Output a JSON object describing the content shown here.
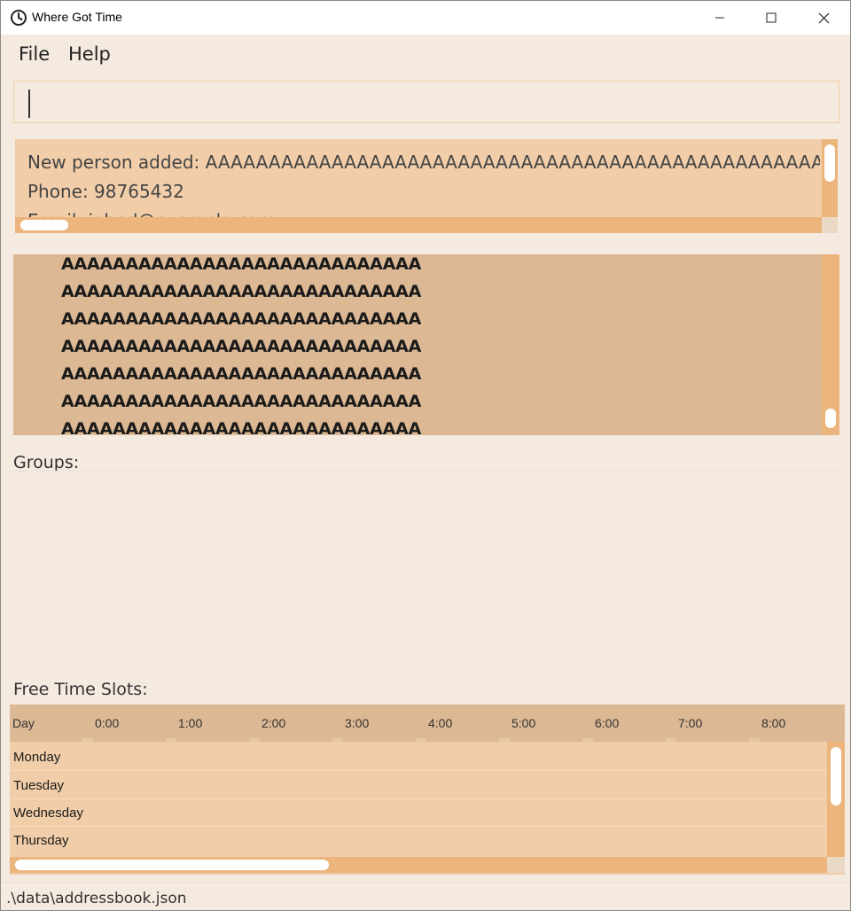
{
  "window": {
    "title": "Where Got Time",
    "icon": "clock-icon",
    "controls": [
      "minimize-icon",
      "maximize-icon",
      "close-icon"
    ]
  },
  "menu": {
    "file": "File",
    "help": "Help"
  },
  "command_box": {
    "value": ""
  },
  "result_display": {
    "lines": [
      "New person added: AAAAAAAAAAAAAAAAAAAAAAAAAAAAAAAAAAAAAAAAAAAAAAAAAAAAAAAA",
      "Phone: 98765432",
      "Email: johnd@example.com"
    ]
  },
  "person_list": {
    "rows": [
      "AAAAAAAAAAAAAAAAAAAAAAAAAAAA",
      "AAAAAAAAAAAAAAAAAAAAAAAAAAAA",
      "AAAAAAAAAAAAAAAAAAAAAAAAAAAA",
      "AAAAAAAAAAAAAAAAAAAAAAAAAAAA",
      "AAAAAAAAAAAAAAAAAAAAAAAAAAAA",
      "AAAAAAAAAAAAAAAAAAAAAAAAAAAA",
      "AAAAAAAAAAAAAAAAAAAAAAAAAAAA"
    ]
  },
  "groups": {
    "label": "Groups:"
  },
  "free_time_slots": {
    "label": "Free Time Slots:",
    "columns": [
      "Day",
      "0:00",
      "1:00",
      "2:00",
      "3:00",
      "4:00",
      "5:00",
      "6:00",
      "7:00",
      "8:00"
    ],
    "rows": [
      "Monday",
      "Tuesday",
      "Wednesday",
      "Thursday"
    ]
  },
  "status_bar": {
    "path": ".\\data\\addressbook.json"
  },
  "colors": {
    "background": "#f5eae0",
    "result_bg": "#f1cea9",
    "list_bg": "#dcb894",
    "scrollbar": "#ebb57d"
  }
}
